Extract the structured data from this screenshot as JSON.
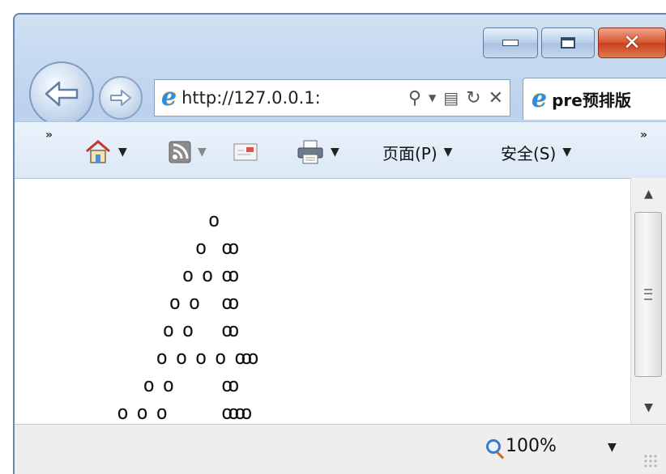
{
  "address_bar": {
    "url": "http://127.0.0.1:",
    "search_icon": "search-icon",
    "dropdown_icon": "chevron-down-icon",
    "compat_icon": "compatibility-icon",
    "refresh_icon": "refresh-icon",
    "stop_icon": "close-icon"
  },
  "tab": {
    "title": "pre预排版"
  },
  "command_bar": {
    "chevron_left": "»",
    "chevron_right": "»",
    "page_menu": "页面(P)",
    "safety_menu": "安全(S)"
  },
  "content": {
    "pre_lines": [
      "                   o",
      "                 o   oo",
      "               o  o  oo",
      "             o  o    oo",
      "            o  o     oo",
      "           o  o  o  o  ooo",
      "         o  o        oo",
      "     o  o  o         oooo"
    ]
  },
  "status_bar": {
    "zoom_label": "100%"
  },
  "colors": {
    "ie_blue": "#2a8ee8",
    "close_red": "#d8532e",
    "frame_blue": "#bcd2ec"
  }
}
